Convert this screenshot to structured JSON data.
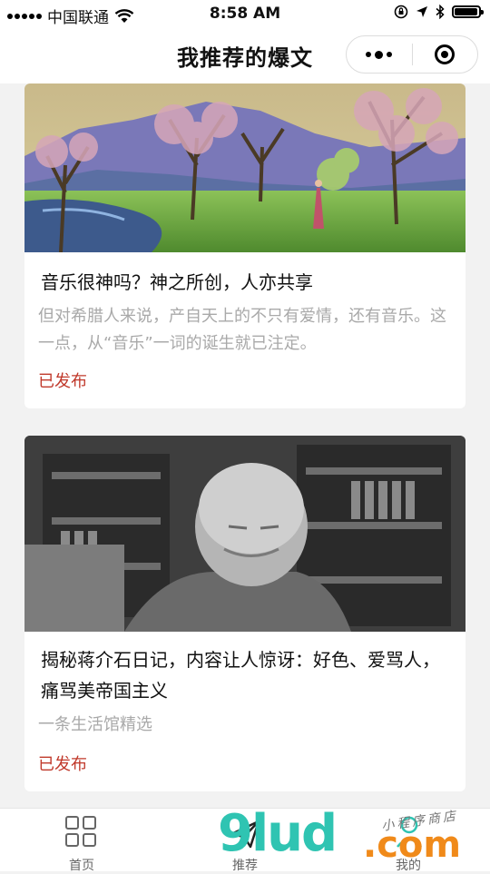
{
  "status_bar": {
    "carrier": "中国联通",
    "time": "8:58 AM"
  },
  "navbar": {
    "title": "我推荐的爆文"
  },
  "articles": [
    {
      "title": "音乐很神吗？神之所创，人亦共享",
      "desc": "但对希腊人来说，产自天上的不只有爱情，还有音乐。这一点，从“音乐”一词的诞生就已注定。",
      "status": "已发布",
      "image": "landscape-painting"
    },
    {
      "title": "揭秘蒋介石日记，内容让人惊讶：好色、爱骂人，痛骂美帝国主义",
      "desc": "一条生活馆精选",
      "status": "已发布",
      "image": "portrait-photo"
    }
  ],
  "tabbar": {
    "tabs": [
      {
        "label": "首页",
        "icon": "grid-icon"
      },
      {
        "label": "推荐",
        "icon": "paper-plane-icon"
      },
      {
        "label": "我的",
        "icon": "user-icon"
      }
    ]
  },
  "watermark": {
    "main": "9lud",
    "suffix": ".com",
    "tagline": "小程序商店"
  },
  "colors": {
    "status_published": "#c0392b",
    "active_tab": "#2fc4b2",
    "background": "#f2f2f2"
  }
}
